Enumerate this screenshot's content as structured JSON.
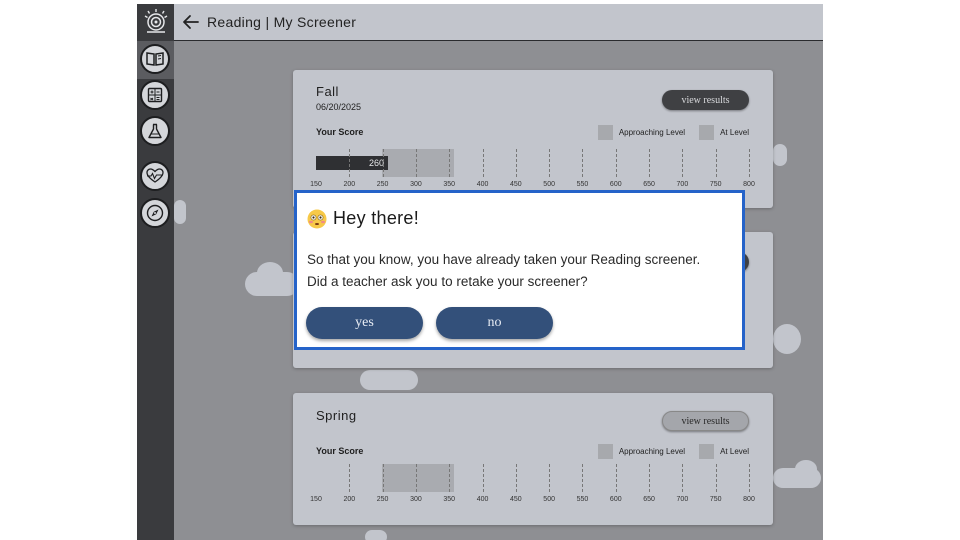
{
  "header": {
    "title": "Reading | My Screener"
  },
  "sidebar": {
    "items": [
      {
        "icon": "book-icon",
        "active": true
      },
      {
        "icon": "calculator-icon",
        "active": false
      },
      {
        "icon": "flask-icon",
        "active": false
      },
      {
        "icon": "heart-pulse-icon",
        "active": false
      },
      {
        "icon": "compass-icon",
        "active": false
      }
    ]
  },
  "cards": [
    {
      "season": "Fall",
      "date": "06/20/2025",
      "view_results": "view results",
      "your_score_label": "Your Score",
      "score": "260",
      "score_value": 260
    },
    {
      "season": "Spring",
      "view_results": "view results",
      "your_score_label": "Your Score"
    }
  ],
  "legend": {
    "approaching": "Approaching Level",
    "at_level": "At Level"
  },
  "scale_ticks": [
    "150",
    "200",
    "250",
    "300",
    "350",
    "400",
    "450",
    "500",
    "550",
    "600",
    "650",
    "700",
    "750",
    "800"
  ],
  "modal": {
    "greeting": "Hey there!",
    "line1": "So that you know, you have already taken your Reading screener.",
    "line2": "Did a teacher ask you to retake your screener?",
    "yes": "yes",
    "no": "no"
  },
  "colors": {
    "accent": "#2563c9",
    "button": "#33507a",
    "sidebar": "#3a3b3e",
    "panel": "#c2c5cc"
  }
}
